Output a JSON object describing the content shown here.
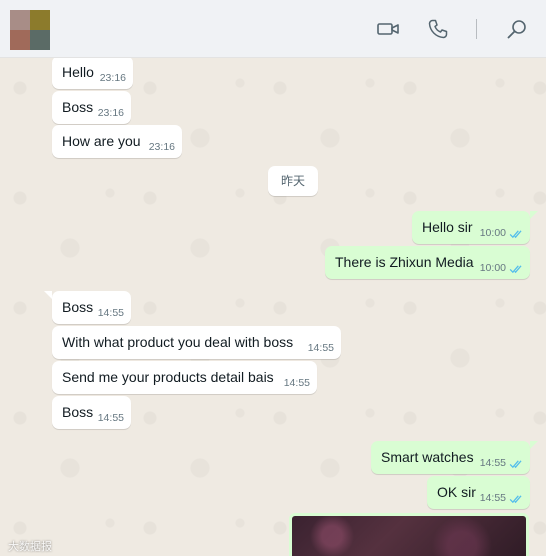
{
  "colors": {
    "header_bg": "#f0f2f5",
    "chat_bg": "#efeae2",
    "incoming_bubble": "#ffffff",
    "outgoing_bubble": "#d9fdd3",
    "read_ticks": "#53bdeb"
  },
  "header": {
    "avatar_tiles": [
      "#a88d87",
      "#8c7b2c",
      "#a06a5a",
      "#5b6b66"
    ],
    "icons": [
      "video-call-icon",
      "voice-call-icon",
      "search-icon"
    ]
  },
  "date_separator": "昨天",
  "messages": [
    {
      "text": "Hello",
      "time": "23:16",
      "direction": "in"
    },
    {
      "text": "Boss",
      "time": "23:16",
      "direction": "in"
    },
    {
      "text": "How are you",
      "time": "23:16",
      "direction": "in"
    },
    {
      "text": "Hello sir",
      "time": "10:00",
      "direction": "out",
      "status": "read"
    },
    {
      "text": "There is Zhixun Media",
      "time": "10:00",
      "direction": "out",
      "status": "read"
    },
    {
      "text": "Boss",
      "time": "14:55",
      "direction": "in"
    },
    {
      "text": "With what product you deal with boss",
      "time": "14:55",
      "direction": "in"
    },
    {
      "text": "Send me your products detail bais",
      "time": "14:55",
      "direction": "in"
    },
    {
      "text": "Boss",
      "time": "14:55",
      "direction": "in"
    },
    {
      "text": "Smart watches",
      "time": "14:55",
      "direction": "out",
      "status": "read"
    },
    {
      "text": "OK sir",
      "time": "14:55",
      "direction": "out",
      "status": "read"
    }
  ],
  "watermark": "大数据报"
}
